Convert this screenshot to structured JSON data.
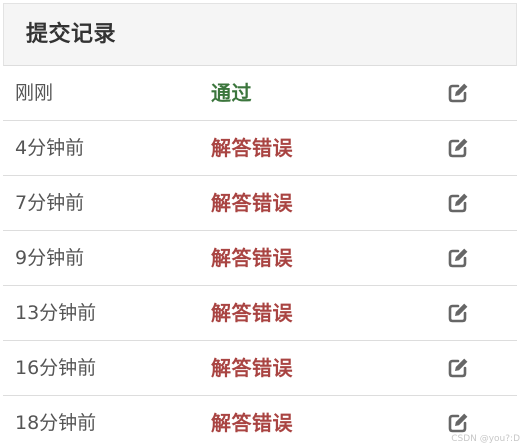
{
  "header": {
    "title": "提交记录"
  },
  "colors": {
    "accepted": "#3c763d",
    "wrong": "#a94442",
    "icon": "#666666"
  },
  "submissions": [
    {
      "time": "刚刚",
      "status": "通过",
      "result": "accepted",
      "action_icon": "edit-icon"
    },
    {
      "time": "4分钟前",
      "status": "解答错误",
      "result": "wrong",
      "action_icon": "edit-icon"
    },
    {
      "time": "7分钟前",
      "status": "解答错误",
      "result": "wrong",
      "action_icon": "edit-icon"
    },
    {
      "time": "9分钟前",
      "status": "解答错误",
      "result": "wrong",
      "action_icon": "edit-icon"
    },
    {
      "time": "13分钟前",
      "status": "解答错误",
      "result": "wrong",
      "action_icon": "edit-icon"
    },
    {
      "time": "16分钟前",
      "status": "解答错误",
      "result": "wrong",
      "action_icon": "edit-icon"
    },
    {
      "time": "18分钟前",
      "status": "解答错误",
      "result": "wrong",
      "action_icon": "edit-icon"
    }
  ],
  "watermark": "CSDN @you?:D"
}
